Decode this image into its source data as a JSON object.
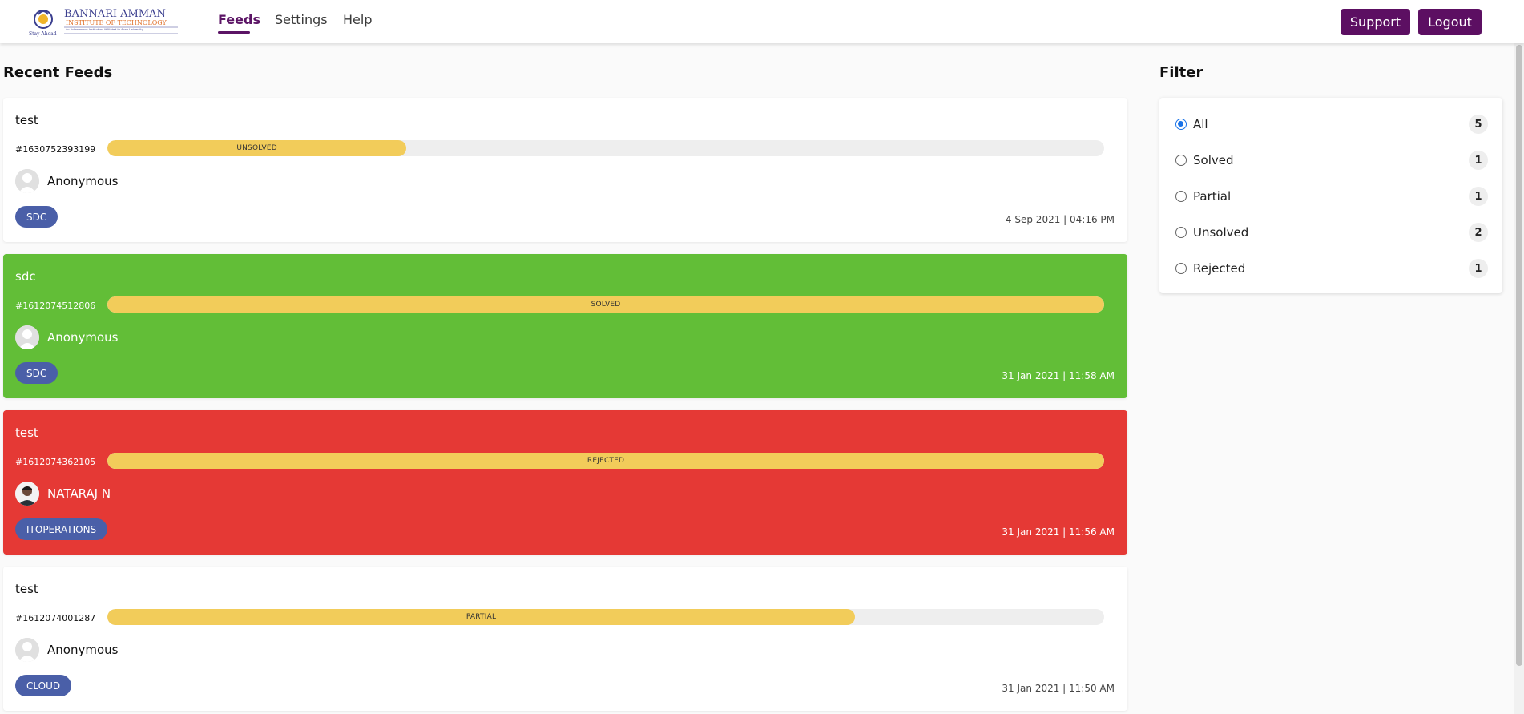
{
  "header": {
    "logo": {
      "name": "BANNARI AMMAN",
      "subtitle": "INSTITUTE OF TECHNOLOGY",
      "tagline": "Stay Ahead",
      "small_print": "An Autonomous Institution Affiliated to Anna University"
    },
    "nav": [
      {
        "label": "Feeds",
        "active": true
      },
      {
        "label": "Settings",
        "active": false
      },
      {
        "label": "Help",
        "active": false
      }
    ],
    "support_label": "Support",
    "logout_label": "Logout"
  },
  "feeds": {
    "title": "Recent Feeds",
    "items": [
      {
        "title": "test",
        "id": "#1630752393199",
        "status": "UNSOLVED",
        "progress": 0.3,
        "author": "Anonymous",
        "tag": "SDC",
        "timestamp": "4 Sep 2021 | 04:16 PM",
        "card_color": "white"
      },
      {
        "title": "sdc",
        "id": "#1612074512806",
        "status": "SOLVED",
        "progress": 1.0,
        "author": "Anonymous",
        "tag": "SDC",
        "timestamp": "31 Jan 2021 | 11:58 AM",
        "card_color": "green"
      },
      {
        "title": "test",
        "id": "#1612074362105",
        "status": "REJECTED",
        "progress": 1.0,
        "author": "NATARAJ N",
        "tag": "ITOPERATIONS",
        "timestamp": "31 Jan 2021 | 11:56 AM",
        "card_color": "red"
      },
      {
        "title": "test",
        "id": "#1612074001287",
        "status": "PARTIAL",
        "progress": 0.75,
        "author": "Anonymous",
        "tag": "CLOUD",
        "timestamp": "31 Jan 2021 | 11:50 AM",
        "card_color": "white"
      }
    ]
  },
  "filter": {
    "title": "Filter",
    "options": [
      {
        "label": "All",
        "count": "5",
        "checked": true
      },
      {
        "label": "Solved",
        "count": "1",
        "checked": false
      },
      {
        "label": "Partial",
        "count": "1",
        "checked": false
      },
      {
        "label": "Unsolved",
        "count": "2",
        "checked": false
      },
      {
        "label": "Rejected",
        "count": "1",
        "checked": false
      }
    ]
  },
  "colors": {
    "brand": "#5c0f62",
    "progress": "#f2cc5a",
    "solved": "#62be37",
    "rejected": "#e53935",
    "tag": "#4a5fa8",
    "radio_checked": "#1a73e8"
  },
  "icons": {
    "avatar_default": "user-placeholder-icon",
    "avatar_photo": "user-photo-icon",
    "radio": "radio-button-icon"
  }
}
